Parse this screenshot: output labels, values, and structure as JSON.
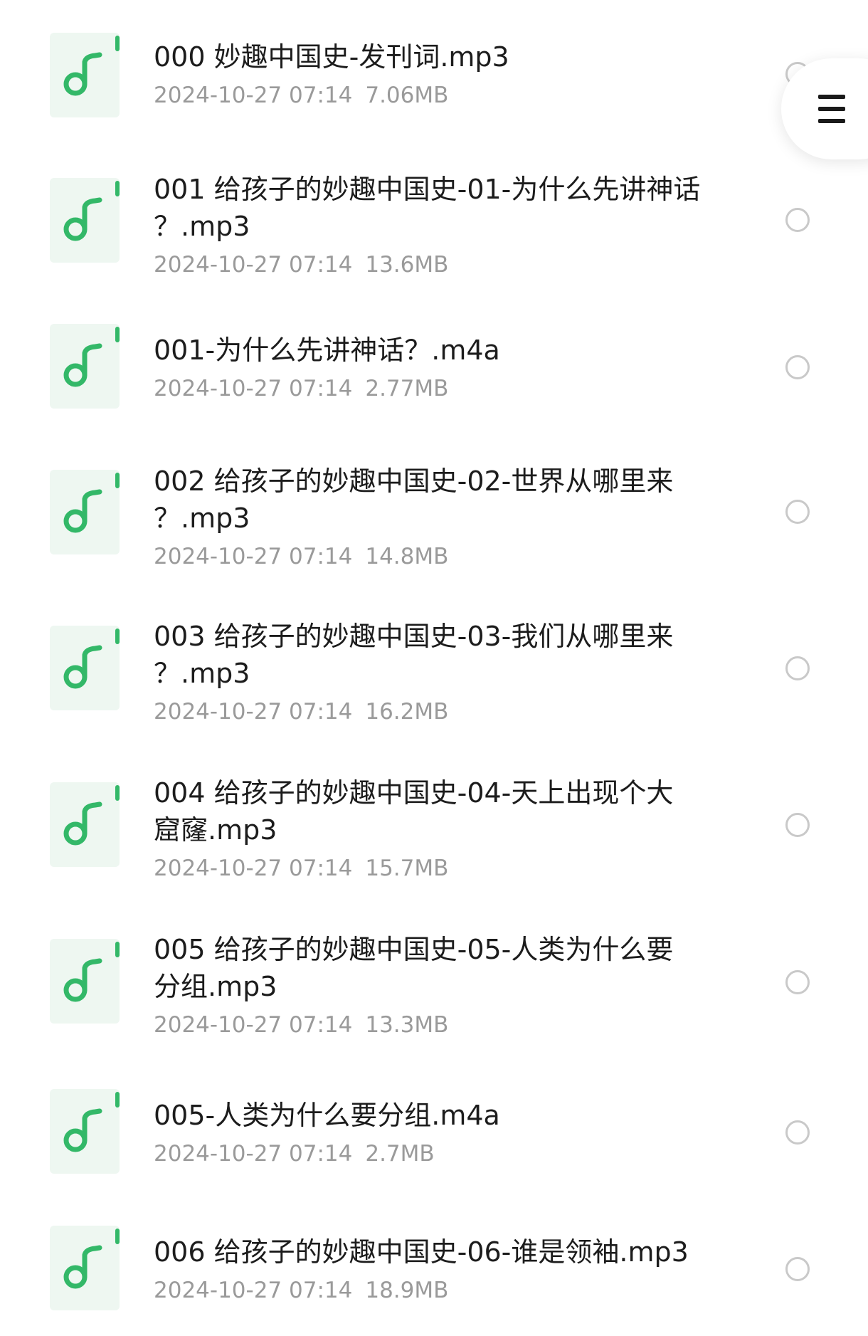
{
  "files": [
    {
      "name_lines": [
        "000 妙趣中国史-发刊词.mp3"
      ],
      "date": "2024-10-27 07:14",
      "size": "7.06MB"
    },
    {
      "name_lines": [
        "001 给孩子的妙趣中国史-01-为什么先讲神话",
        "？.mp3"
      ],
      "date": "2024-10-27 07:14",
      "size": "13.6MB"
    },
    {
      "name_lines": [
        "001-为什么先讲神话？.m4a"
      ],
      "date": "2024-10-27 07:14",
      "size": "2.77MB"
    },
    {
      "name_lines": [
        "002 给孩子的妙趣中国史-02-世界从哪里来",
        "？.mp3"
      ],
      "date": "2024-10-27 07:14",
      "size": "14.8MB"
    },
    {
      "name_lines": [
        "003 给孩子的妙趣中国史-03-我们从哪里来",
        "？.mp3"
      ],
      "date": "2024-10-27 07:14",
      "size": "16.2MB"
    },
    {
      "name_lines": [
        "004 给孩子的妙趣中国史-04-天上出现个大",
        "窟窿.mp3"
      ],
      "date": "2024-10-27 07:14",
      "size": "15.7MB"
    },
    {
      "name_lines": [
        "005 给孩子的妙趣中国史-05-人类为什么要",
        "分组.mp3"
      ],
      "date": "2024-10-27 07:14",
      "size": "13.3MB"
    },
    {
      "name_lines": [
        "005-人类为什么要分组.m4a"
      ],
      "date": "2024-10-27 07:14",
      "size": "2.7MB"
    },
    {
      "name_lines": [
        "006 给孩子的妙趣中国史-06-谁是领袖.mp3"
      ],
      "date": "2024-10-27 07:14",
      "size": "18.9MB"
    }
  ],
  "icons": {
    "file_type": "music-note-icon",
    "menu": "hamburger-menu-icon",
    "selection": "radio-circle-icon"
  },
  "colors": {
    "accent_green": "#33b868",
    "icon_bg": "#eef7f1",
    "meta_text": "#9a9a9a",
    "radio_border": "#c9c9c9"
  }
}
